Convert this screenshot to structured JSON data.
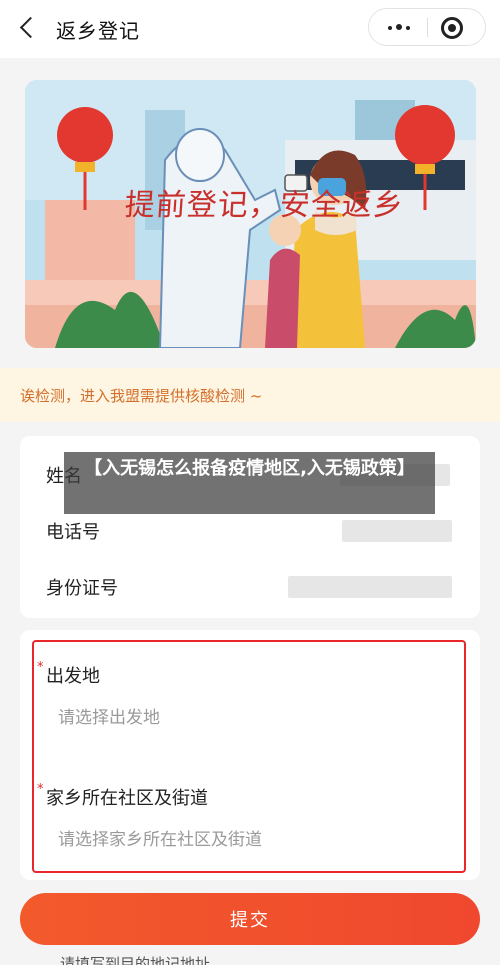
{
  "header": {
    "title": "返乡登记",
    "back_icon": "chevron-left-icon",
    "more_icon": "more-dots-icon",
    "target_icon": "target-icon"
  },
  "banner": {
    "slogan": "提前登记，安全返乡"
  },
  "notice": {
    "text": "诶检测，进入我盟需提供核酸检测 ~"
  },
  "info_card": {
    "fields": [
      {
        "label": "姓名"
      },
      {
        "label": "电话号"
      },
      {
        "label": "身份证号"
      }
    ]
  },
  "form": {
    "required_mark": "*",
    "departure": {
      "label": "出发地",
      "placeholder": "请选择出发地"
    },
    "hometown": {
      "label": "家乡所在社区及街道",
      "placeholder": "请选择家乡所在社区及街道"
    }
  },
  "submit": {
    "label": "提交"
  },
  "bottom_peek": {
    "text": "请填写到目的地记地址"
  },
  "overlay": {
    "caption": "【入无锡怎么报备疫情地区,入无锡政策】"
  },
  "colors": {
    "accent": "#f0482e",
    "required": "#e8262b",
    "notice_text": "#d2702b",
    "notice_bg": "#fff5e3"
  }
}
